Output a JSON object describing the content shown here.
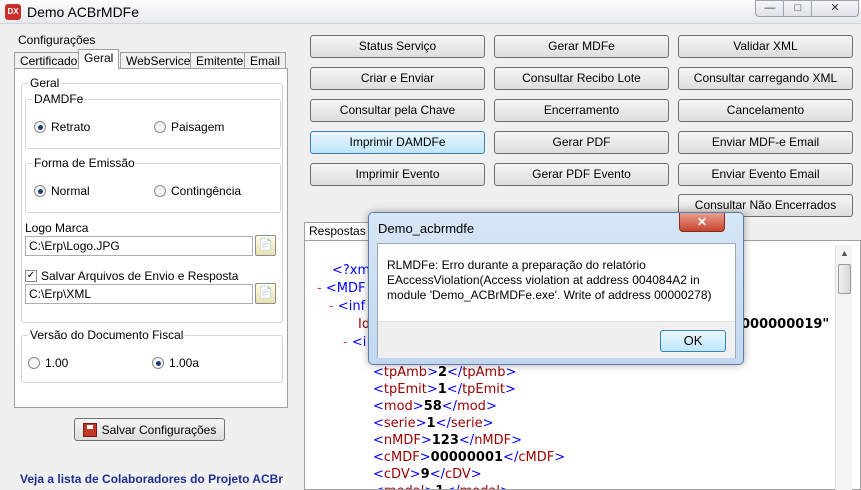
{
  "window": {
    "title": "Demo ACBrMDFe",
    "app_icon_text": "DX"
  },
  "settings": {
    "section_label": "Configurações",
    "tabs": [
      {
        "label": "Certificado"
      },
      {
        "label": "Geral"
      },
      {
        "label": "WebService"
      },
      {
        "label": "Emitente"
      },
      {
        "label": "Email"
      }
    ],
    "geral_label": "Geral",
    "damdfe": {
      "title": "DAMDFe",
      "option_retrato": "Retrato",
      "option_paisagem": "Paisagem"
    },
    "forma_emissao": {
      "title": "Forma de Emissão",
      "option_normal": "Normal",
      "option_contingencia": "Contingência"
    },
    "logo": {
      "label": "Logo Marca",
      "value": "C:\\Erp\\Logo.JPG"
    },
    "salvar_arquivos": {
      "label": "Salvar Arquivos de Envio e Resposta",
      "checked": true,
      "value": "C:\\Erp\\XML"
    },
    "versao": {
      "title": "Versão do Documento Fiscal",
      "option_100": "1.00",
      "option_100a": "1.00a"
    },
    "save_button": "Salvar Configurações",
    "colaboradores_link": "Veja a lista de Colaboradores do Projeto ACBr"
  },
  "actions": {
    "status_servico": "Status Serviço",
    "gerar_mdfe": "Gerar MDFe",
    "validar_xml": "Validar XML",
    "criar_enviar": "Criar e Enviar",
    "consultar_recibo_lote": "Consultar Recibo Lote",
    "consultar_carregando_xml": "Consultar carregando XML",
    "consultar_chave": "Consultar pela Chave",
    "encerramento": "Encerramento",
    "cancelamento": "Cancelamento",
    "imprimir_damdfe": "Imprimir DAMDFe",
    "gerar_pdf": "Gerar PDF",
    "enviar_mdfe_email": "Enviar MDF-e Email",
    "imprimir_evento": "Imprimir Evento",
    "gerar_pdf_evento": "Gerar PDF Evento",
    "enviar_evento_email": "Enviar Evento Email",
    "consultar_nao_encerrados": "Consultar Não Encerrados"
  },
  "output": {
    "tab_respostas": "Respostas",
    "xml_partial_value": "000000019\"",
    "xml": {
      "xml_decl": "<?xml",
      "mdfe_open": "<MDF",
      "inf_open": "<inf",
      "id_attr": "Id",
      "i_open": "<i",
      "tpAmb": "2",
      "tpEmit": "1",
      "mod": "58",
      "serie": "1",
      "nMDF": "123",
      "cMDF": "00000001",
      "cDV": "9",
      "modal": "1"
    }
  },
  "dialog": {
    "title": "Demo_acbrmdfe",
    "message": "RLMDFe: Erro durante a preparação do relatório EAccessViolation(Access violation at address 004084A2 in module 'Demo_ACBrMDFe.exe'. Write of address 00000278)",
    "ok": "OK"
  }
}
